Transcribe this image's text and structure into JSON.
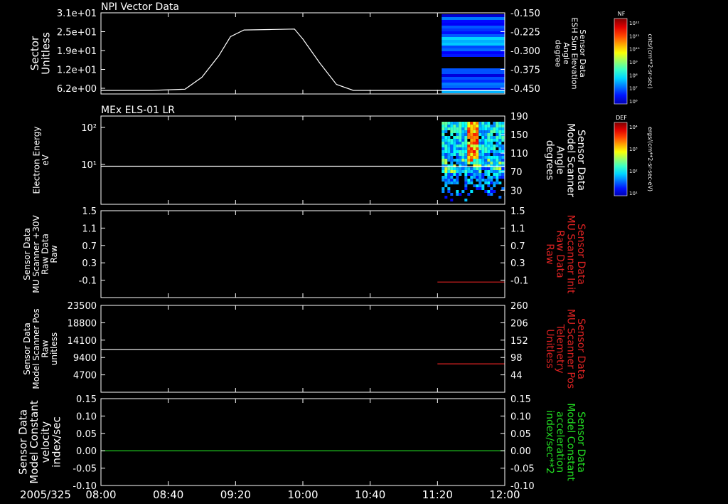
{
  "time_axis": {
    "date_label": "2005/325",
    "ticks": [
      "08:00",
      "08:40",
      "09:20",
      "10:00",
      "10:40",
      "11:20",
      "12:00"
    ]
  },
  "colors": {
    "background": "#000000",
    "axis": "#ffffff",
    "red_trace": "#dd2222",
    "green_trace": "#22dd22"
  },
  "colorbars": [
    {
      "title": "NF",
      "units": "cnts/(cm**2-sr-sec)",
      "ticks": [
        "10¹²",
        "10¹¹",
        "10¹⁰",
        "10⁹",
        "10⁸",
        "10⁷",
        "10⁶"
      ]
    },
    {
      "title": "DEF",
      "units": "ergs/(cm**2-sr-sec-eV)",
      "ticks": [
        "10⁴",
        "10³",
        "10²",
        "10¹"
      ]
    }
  ],
  "chart_data": [
    {
      "type": "line",
      "title": "NPI Vector Data",
      "left_label": [
        "Sector",
        "Unitless"
      ],
      "left_ticks": [
        "3.1e+01",
        "2.5e+01",
        "1.9e+01",
        "1.2e+01",
        "6.2e+00"
      ],
      "right_label": [
        "Sensor Data",
        "ESH Sun Elevation",
        "Angle",
        "degree"
      ],
      "right_ticks": [
        "-0.150",
        "-0.225",
        "-0.300",
        "-0.375",
        "-0.450"
      ],
      "ylim": [
        -0.49,
        -0.15
      ],
      "series": [
        {
          "color": "#ffffff",
          "x": [
            "08:00",
            "08:20",
            "08:30",
            "08:50",
            "09:00",
            "09:10",
            "09:17",
            "09:25",
            "09:40",
            "09:55",
            "10:00",
            "10:10",
            "10:20",
            "10:30",
            "11:20",
            "12:00"
          ],
          "y": [
            -0.475,
            -0.475,
            -0.475,
            -0.47,
            -0.42,
            -0.33,
            -0.25,
            -0.222,
            -0.22,
            -0.218,
            -0.26,
            -0.36,
            -0.45,
            -0.475,
            -0.475,
            -0.475
          ]
        }
      ],
      "spectrogram": {
        "x_range": [
          "11:20",
          "12:00"
        ],
        "colorbar": "NF"
      }
    },
    {
      "type": "heatmap",
      "title": "MEx ELS-01 LR",
      "left_label": [
        "Electron Energy",
        "eV"
      ],
      "left_ticks": [
        "10²",
        "10¹"
      ],
      "left_scale": "log",
      "right_label": [
        "Sensor Data",
        "Model Scanner",
        "Angle",
        "degrees"
      ],
      "right_ticks": [
        "190",
        "150",
        "110",
        "70",
        "30"
      ],
      "ylim": [
        0,
        190
      ],
      "series": [
        {
          "color": "#ffffff",
          "x": [
            "08:00",
            "12:00"
          ],
          "y": [
            82,
            82
          ]
        }
      ],
      "spectrogram": {
        "x_range": [
          "11:20",
          "12:00"
        ],
        "colorbar": "DEF"
      }
    },
    {
      "type": "line",
      "left_label": [
        "Sensor Data",
        "MU Scanner +30V",
        "Raw Data",
        "Raw"
      ],
      "left_ticks": [
        "1.5",
        "1.1",
        "0.7",
        "0.3",
        "-0.1"
      ],
      "right_label": [
        "Sensor Data",
        "MU Scanner Init",
        "Raw Data",
        "Raw"
      ],
      "right_label_color": "#dd2222",
      "right_ticks": [
        "1.5",
        "1.1",
        "0.7",
        "0.3",
        "-0.1"
      ],
      "ylim": [
        -0.35,
        1.5
      ],
      "series": [
        {
          "color": "#dd2222",
          "x": [
            "11:20",
            "12:00"
          ],
          "y": [
            -0.02,
            -0.02
          ]
        }
      ]
    },
    {
      "type": "line",
      "left_label": [
        "Sensor Data",
        "Model Scanner Pos",
        "Raw",
        "unitless"
      ],
      "left_ticks": [
        "23500",
        "18800",
        "14100",
        "9400",
        "4700"
      ],
      "right_label": [
        "Sensor Data",
        "MU Scanner Pos",
        "Telemetry",
        "Unitless"
      ],
      "right_label_color": "#dd2222",
      "right_ticks": [
        "260",
        "206",
        "152",
        "98",
        "44"
      ],
      "ylim": [
        0,
        23500
      ],
      "right_ylim": [
        0,
        260
      ],
      "series": [
        {
          "color": "#ffffff",
          "x": [
            "08:00",
            "12:00"
          ],
          "y": [
            11600,
            11600
          ]
        },
        {
          "color": "#dd2222",
          "axis": "right",
          "x": [
            "11:20",
            "12:00"
          ],
          "y": [
            85,
            85
          ]
        }
      ]
    },
    {
      "type": "line",
      "left_label": [
        "Sensor Data",
        "Model Constant",
        "velocity",
        "index/sec"
      ],
      "left_ticks": [
        "0.15",
        "0.10",
        "0.05",
        "0.00",
        "-0.05",
        "-0.10"
      ],
      "right_label": [
        "Sensor Data",
        "Model Constant",
        "acceleration",
        "index/sec**2"
      ],
      "right_label_color": "#22dd22",
      "right_ticks": [
        "0.15",
        "0.10",
        "0.05",
        "0.00",
        "-0.05",
        "-0.10"
      ],
      "ylim": [
        -0.1,
        0.15
      ],
      "series": [
        {
          "color": "#22dd22",
          "x": [
            "08:00",
            "12:00"
          ],
          "y": [
            0,
            0
          ]
        }
      ]
    }
  ]
}
